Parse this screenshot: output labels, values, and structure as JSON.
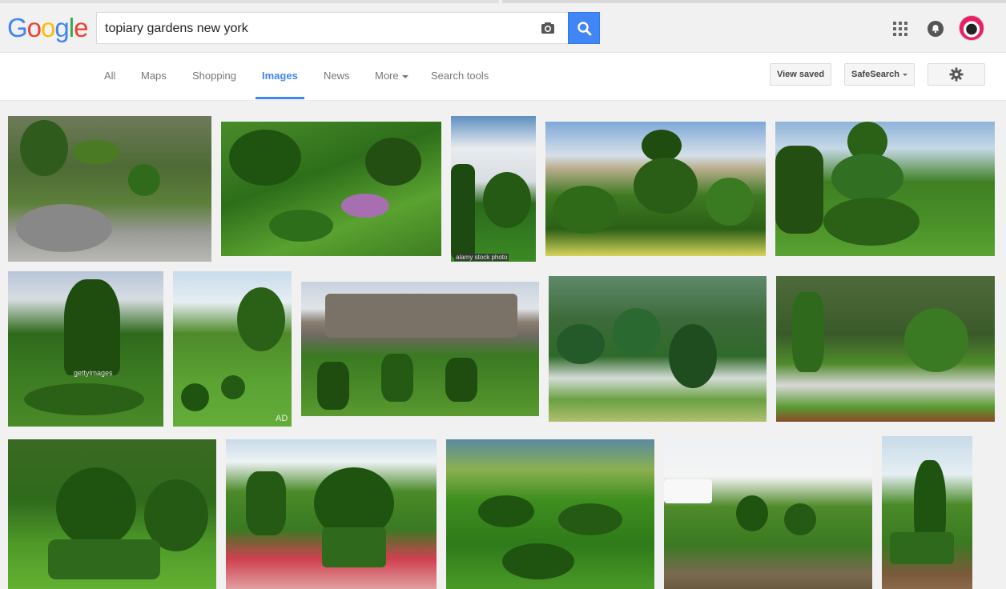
{
  "search": {
    "query": "topiary gardens new york"
  },
  "nav": {
    "tabs": [
      {
        "label": "All"
      },
      {
        "label": "Maps"
      },
      {
        "label": "Shopping"
      },
      {
        "label": "Images",
        "active": true
      },
      {
        "label": "News"
      },
      {
        "label": "More"
      },
      {
        "label": "Search tools"
      }
    ],
    "view_saved": "View saved",
    "safesearch": "SafeSearch"
  },
  "logo": {
    "text": "Google",
    "colors": [
      "#4285f4",
      "#ea4335",
      "#fbbc05",
      "#4285f4",
      "#34a853",
      "#ea4335"
    ]
  },
  "watermarks": {
    "alamy": "alamy stock photo",
    "getty": "gettyimages",
    "ad": "AD"
  },
  "colors": {
    "accent": "#4285f4",
    "foliage_dark": "#1f5a12",
    "foliage": "#3f8f1f",
    "foliage_light": "#7cc23a"
  }
}
